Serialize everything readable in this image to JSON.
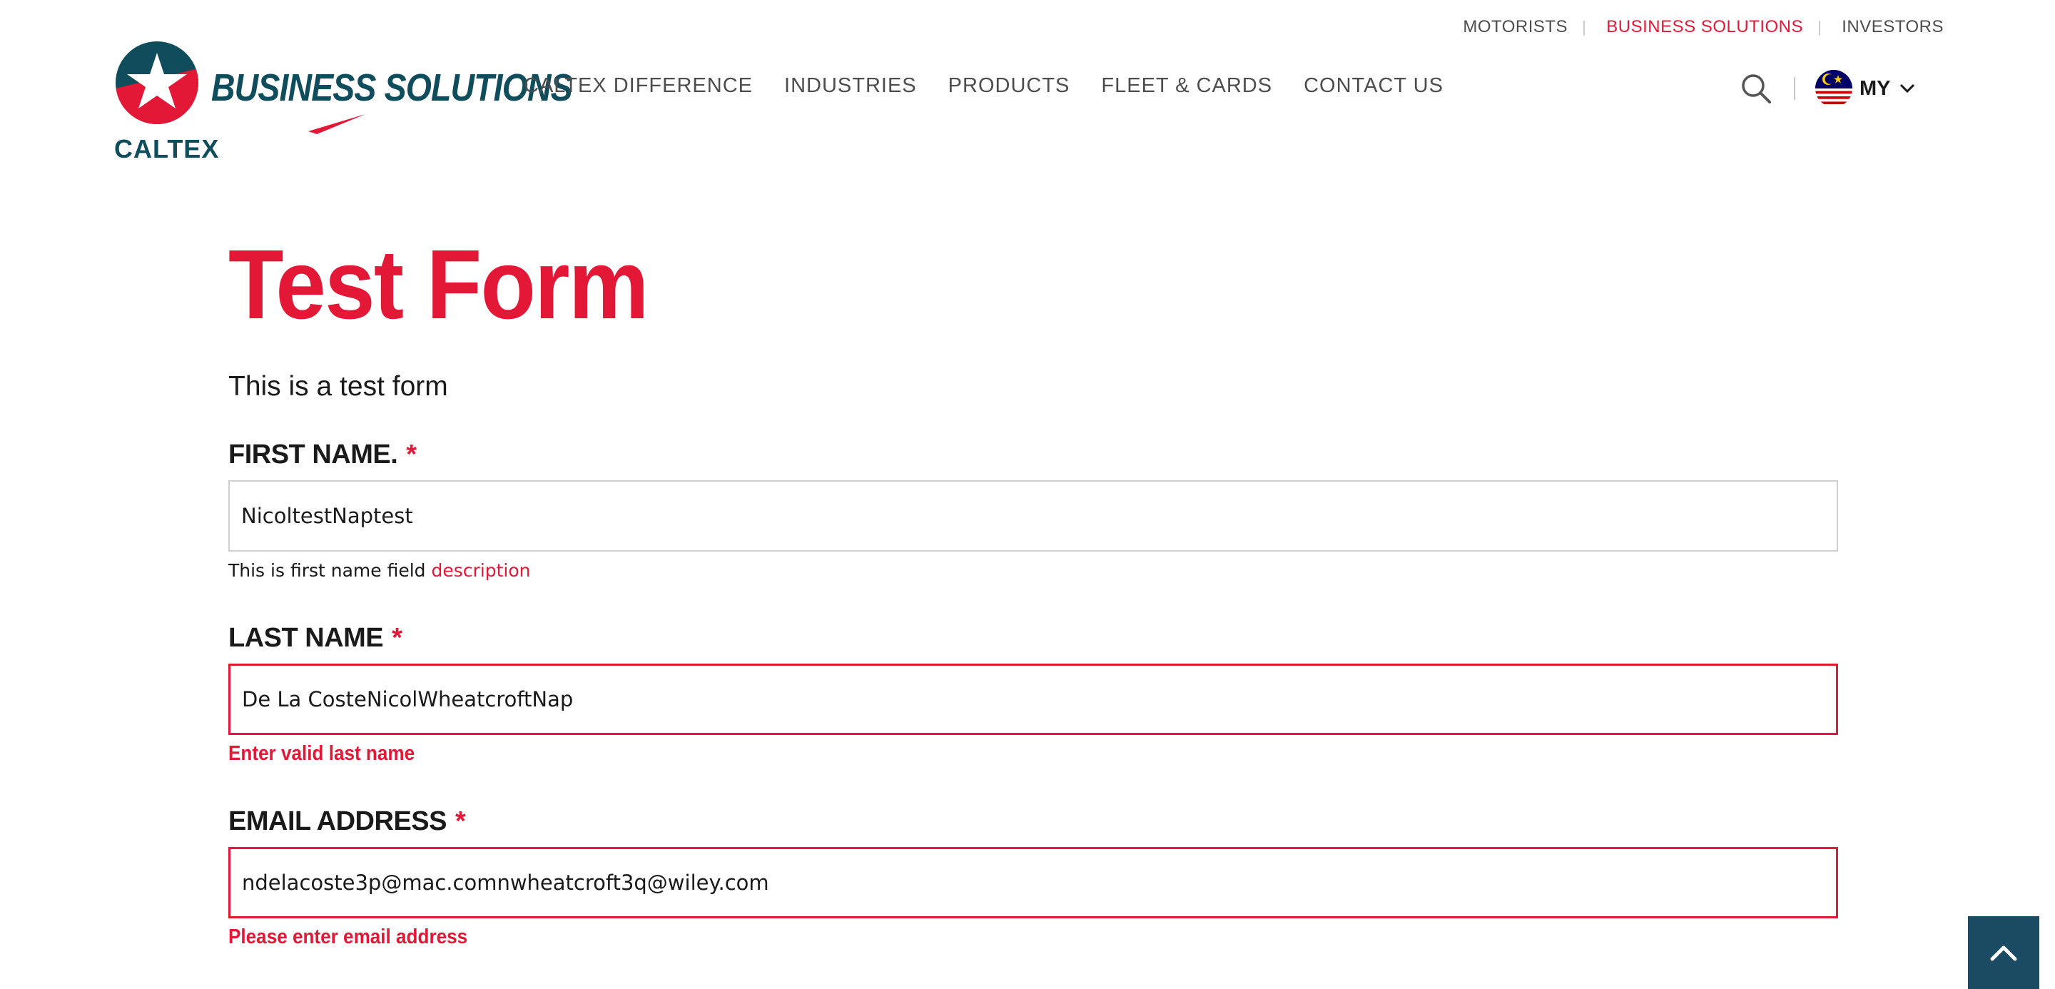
{
  "utility_nav": {
    "items": [
      {
        "label": "MOTORISTS",
        "active": false
      },
      {
        "label": "BUSINESS SOLUTIONS",
        "active": true
      },
      {
        "label": "INVESTORS",
        "active": false
      }
    ]
  },
  "logo": {
    "brand": "CALTEX",
    "subtitle": "BUSINESS SOLUTIONS"
  },
  "main_nav": {
    "items": [
      "CALTEX DIFFERENCE",
      "INDUSTRIES",
      "PRODUCTS",
      "FLEET & CARDS",
      "CONTACT US"
    ]
  },
  "tools": {
    "search_icon": "search-icon",
    "locale": "MY",
    "flag_icon": "malaysia-flag-icon"
  },
  "page": {
    "title": "Test Form",
    "intro": "This is a test form"
  },
  "form": {
    "first_name": {
      "label": "FIRST NAME.",
      "required_mark": "*",
      "value": "NicoltestNaptest",
      "description_text": "This is first name field",
      "description_link": "description"
    },
    "last_name": {
      "label": "LAST NAME",
      "required_mark": "*",
      "value": "De La CosteNicolWheatcroftNap",
      "error": "Enter valid last name"
    },
    "email": {
      "label": "EMAIL ADDRESS",
      "required_mark": "*",
      "value": "ndelacoste3p@mac.comnwheatcroft3q@wiley.com",
      "error": "Please enter email address"
    }
  },
  "back_to_top_icon": "chevron-up-icon",
  "colors": {
    "accent_red": "#e21836",
    "brand_teal": "#0f4c5c",
    "back_to_top_bg": "#1b4a63",
    "nav_text": "#4d4d4d"
  }
}
